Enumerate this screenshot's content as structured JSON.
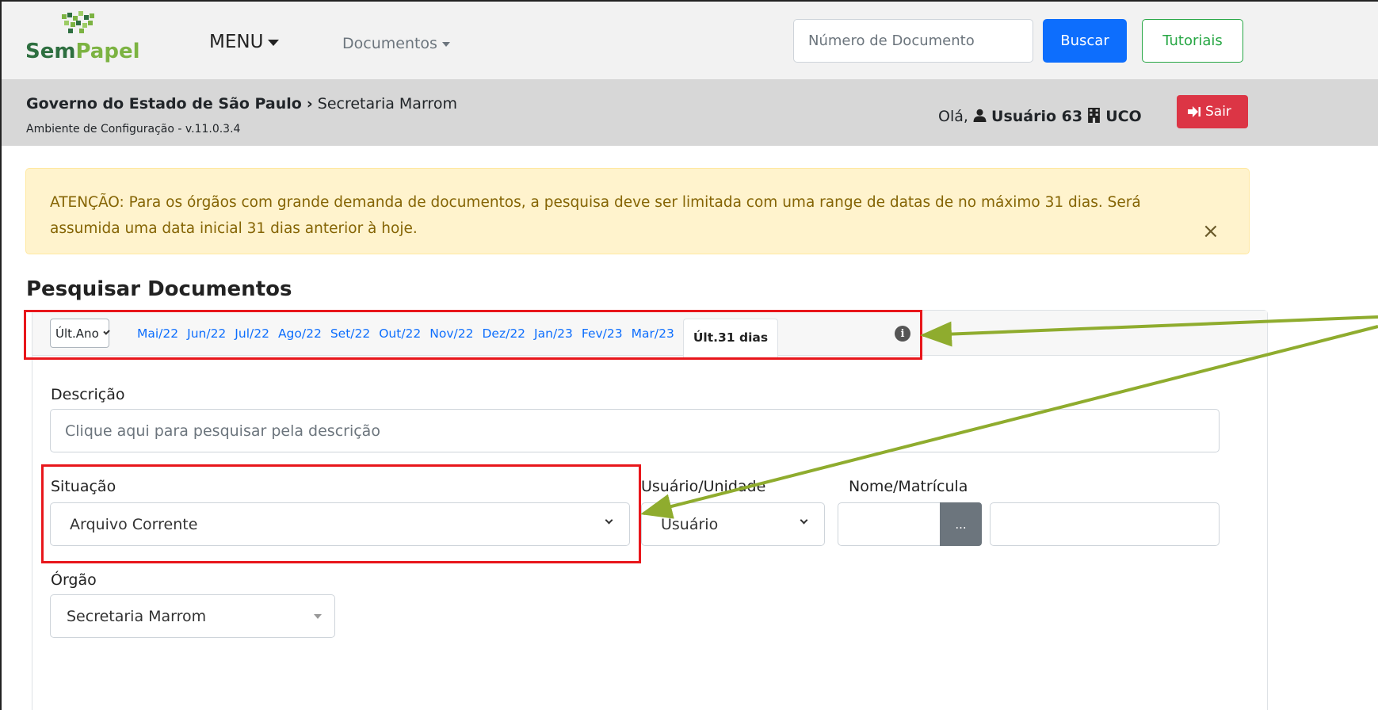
{
  "header": {
    "logo_text_a": "Sem",
    "logo_text_b": "Papel",
    "menu_label": "MENU",
    "docs_menu_label": "Documentos",
    "search_placeholder": "Número de Documento",
    "search_button": "Buscar",
    "tutorials_button": "Tutoriais"
  },
  "subheader": {
    "breadcrumb_org": "Governo do Estado de São Paulo",
    "breadcrumb_sep": "›",
    "breadcrumb_unit": "Secretaria Marrom",
    "environment": "Ambiente de Configuração - v.11.0.3.4",
    "greeting": "Olá,",
    "user_name": "Usuário 63",
    "unit_code": "UCO",
    "logout_label": "Sair"
  },
  "alert": {
    "text": "ATENÇÃO: Para os órgãos com grande demanda de documentos, a pesquisa deve ser limitada com uma range de datas de no máximo 31 dias. Será assumida uma data inicial 31 dias anterior à hoje.",
    "close": "×"
  },
  "search": {
    "title": "Pesquisar Documentos",
    "period_select": "Últ.Ano",
    "months": [
      "Mai/22",
      "Jun/22",
      "Jul/22",
      "Ago/22",
      "Set/22",
      "Out/22",
      "Nov/22",
      "Dez/22",
      "Jan/23",
      "Fev/23",
      "Mar/23"
    ],
    "active_period": "Últ.31 dias",
    "info_icon": "i",
    "description_label": "Descrição",
    "description_placeholder": "Clique aqui para pesquisar pela descrição",
    "situation_label": "Situação",
    "situation_value": "Arquivo Corrente",
    "user_unit_label": "Usuário/Unidade",
    "user_unit_value": "Usuário",
    "name_label": "Nome/Matrícula",
    "dots_button": "...",
    "org_label": "Órgão",
    "org_value": "Secretaria Marrom"
  },
  "colors": {
    "primary": "#0d6efd",
    "success": "#28a745",
    "danger": "#dc3545",
    "alert_bg": "#fff3cd",
    "annotation_red": "#e8161b",
    "annotation_arrow": "#8fac2e"
  }
}
